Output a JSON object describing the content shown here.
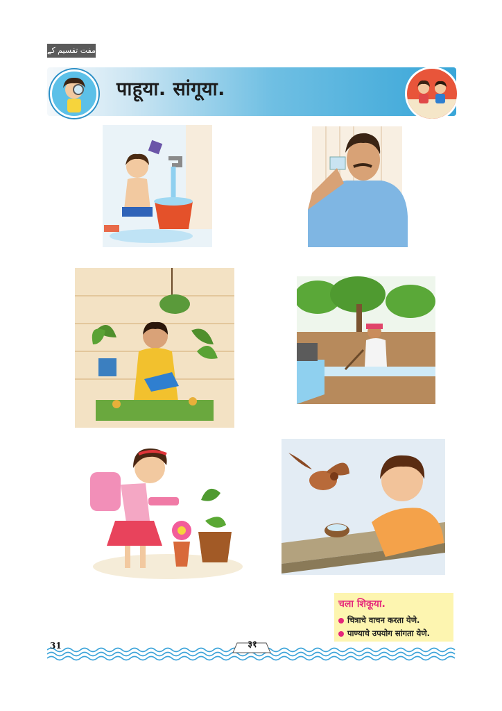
{
  "header": {
    "urdu_tag": "مفت تقسیم کے لیے",
    "title": "पाहूया. सांगूया."
  },
  "illustrations": [
    {
      "name": "child-bathing",
      "icon": "child-pouring-water-bucket"
    },
    {
      "name": "man-drinking-water",
      "icon": "man-drinking-glass"
    },
    {
      "name": "woman-watering-plants",
      "icon": "woman-watering-can-plants"
    },
    {
      "name": "farmer-irrigating-field",
      "icon": "farmer-water-channel"
    },
    {
      "name": "girl-watering-flowerpot",
      "icon": "girl-bottle-plants"
    },
    {
      "name": "boy-giving-water-to-bird",
      "icon": "boy-bird-coconut-bowl"
    }
  ],
  "learning_box": {
    "title": "चला शिकूया.",
    "items": [
      "चित्राचे वाचन करता येणे.",
      "पाण्याचे उपयोग सांगता येणे."
    ]
  },
  "footer": {
    "page_number": "31",
    "page_number_devanagari": "३१"
  },
  "colors": {
    "banner_blue": "#39a6d8",
    "learn_box_bg": "#fdf5b0",
    "accent_pink": "#e5267a",
    "wave_blue": "#3ba3d9"
  }
}
